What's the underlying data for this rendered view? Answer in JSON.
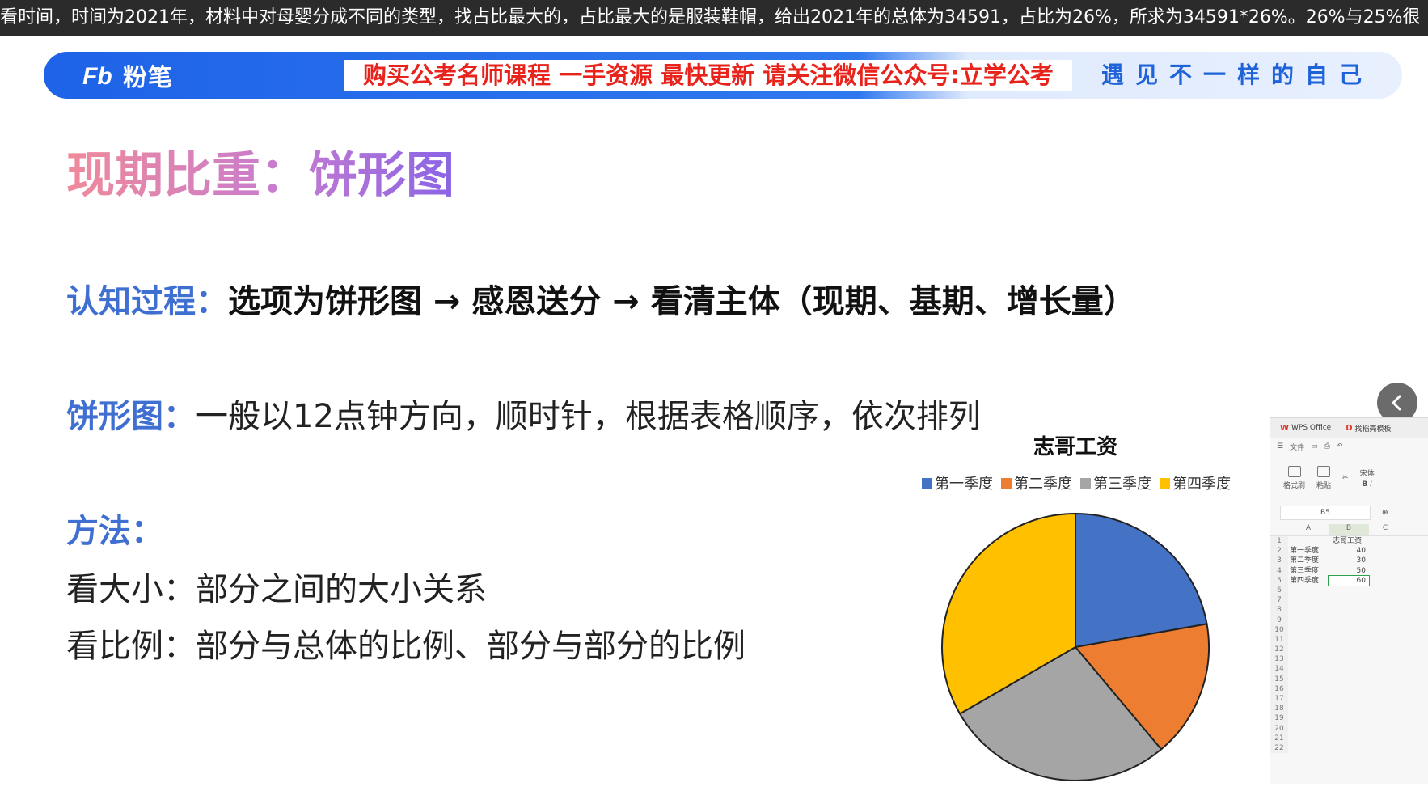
{
  "ticker": {
    "text": "看时间，时间为2021年，材料中对母婴分成不同的类型，找占比最大的，占比最大的是服装鞋帽，给出2021年的总体为34591，占比为26%，所求为34591*26%。26%与25%很"
  },
  "banner": {
    "logo_text": "粉笔",
    "promo_text": "购买公考名师课程 一手资源 最快更新 请关注微信公众号:立学公考",
    "slogan": "遇见不一样的自己"
  },
  "slide": {
    "title": "现期比重：饼形图",
    "cognition_label": "认知过程：",
    "cognition_text": "选项为饼形图 → 感恩送分 → 看清主体（现期、基期、增长量）",
    "pie_label": "饼形图：",
    "pie_text": "一般以12点钟方向，顺时针，根据表格顺序，依次排列",
    "method_label": "方法：",
    "method_1": "看大小：部分之间的大小关系",
    "method_2": "看比例：部分与总体的比例、部分与部分的比例"
  },
  "chart_data": {
    "type": "pie",
    "title": "志哥工资",
    "categories": [
      "第一季度",
      "第二季度",
      "第三季度",
      "第四季度"
    ],
    "values": [
      40,
      30,
      50,
      60
    ],
    "colors": [
      "#4472c4",
      "#ed7d31",
      "#a5a5a5",
      "#ffc000"
    ],
    "start_angle": "12 o'clock",
    "direction": "clockwise",
    "legend_position": "top"
  },
  "wps": {
    "tab_app": "WPS Office",
    "tab_doc": "找稻壳模板",
    "menu_file": "文件",
    "ribbon": [
      "格式刷",
      "粘贴"
    ],
    "font_box": "宋体",
    "cell_ref": "B5",
    "columns": [
      "A",
      "B",
      "C"
    ],
    "header_cell": "志哥工资",
    "rows": [
      {
        "n": "1",
        "a": "",
        "b": "志哥工资"
      },
      {
        "n": "2",
        "a": "第一季度",
        "b": "40"
      },
      {
        "n": "3",
        "a": "第二季度",
        "b": "30"
      },
      {
        "n": "4",
        "a": "第三季度",
        "b": "50"
      },
      {
        "n": "5",
        "a": "第四季度",
        "b": "60"
      },
      {
        "n": "6",
        "a": "",
        "b": ""
      },
      {
        "n": "7",
        "a": "",
        "b": ""
      },
      {
        "n": "8",
        "a": "",
        "b": ""
      },
      {
        "n": "9",
        "a": "",
        "b": ""
      },
      {
        "n": "10",
        "a": "",
        "b": ""
      },
      {
        "n": "11",
        "a": "",
        "b": ""
      },
      {
        "n": "12",
        "a": "",
        "b": ""
      },
      {
        "n": "13",
        "a": "",
        "b": ""
      },
      {
        "n": "14",
        "a": "",
        "b": ""
      },
      {
        "n": "15",
        "a": "",
        "b": ""
      },
      {
        "n": "16",
        "a": "",
        "b": ""
      },
      {
        "n": "17",
        "a": "",
        "b": ""
      },
      {
        "n": "18",
        "a": "",
        "b": ""
      },
      {
        "n": "19",
        "a": "",
        "b": ""
      },
      {
        "n": "20",
        "a": "",
        "b": ""
      },
      {
        "n": "21",
        "a": "",
        "b": ""
      },
      {
        "n": "22",
        "a": "",
        "b": ""
      }
    ]
  }
}
